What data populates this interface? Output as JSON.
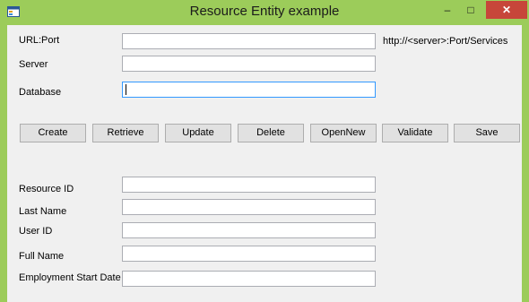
{
  "window": {
    "title": "Resource Entity example",
    "minimize": "–",
    "maximize": "□",
    "close": "✕",
    "icon": "app-window-icon"
  },
  "connection": {
    "url_port_label": "URL:Port",
    "url_port_value": "",
    "url_hint": "http://<server>:Port/Services",
    "server_label": "Server",
    "server_value": "",
    "database_label": "Database",
    "database_value": ""
  },
  "actions": {
    "create": "Create",
    "retrieve": "Retrieve",
    "update": "Update",
    "delete": "Delete",
    "open_new": "OpenNew",
    "validate": "Validate",
    "save": "Save"
  },
  "resource": {
    "resource_id_label": "Resource ID",
    "resource_id_value": "",
    "last_name_label": "Last Name",
    "last_name_value": "",
    "user_id_label": "User ID",
    "user_id_value": "",
    "full_name_label": "Full Name",
    "full_name_value": "",
    "employment_start_label": "Employment Start Date",
    "employment_start_value": ""
  },
  "colors": {
    "frame": "#9ccc5a",
    "client": "#f0f0f0",
    "close_button": "#c7463a",
    "focus_border": "#3399ff"
  }
}
